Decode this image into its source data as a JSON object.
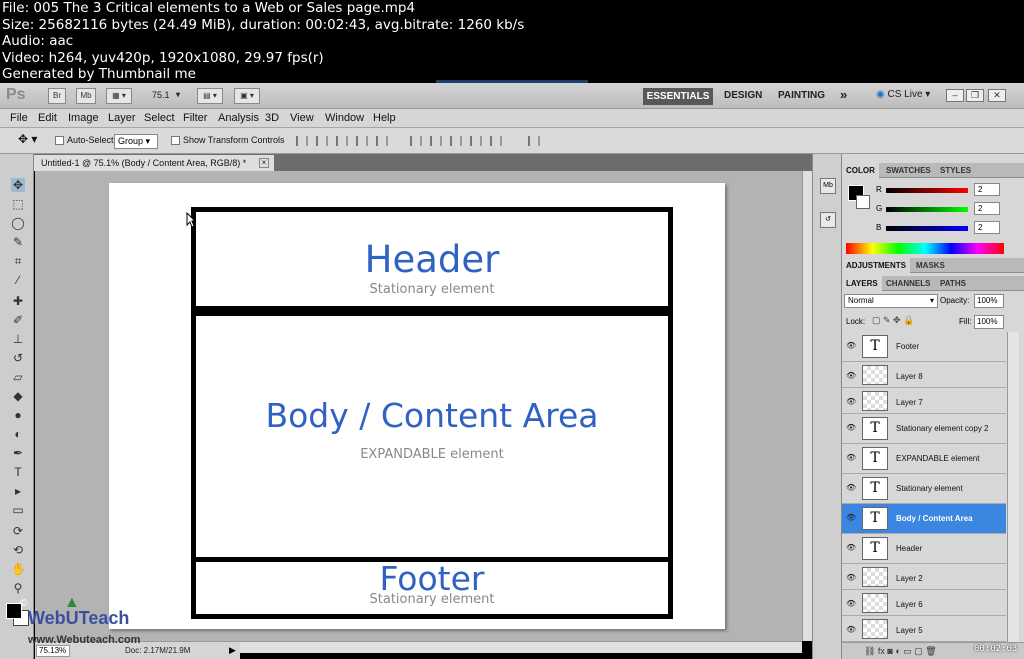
{
  "video_info": [
    "File: 005 The 3 Critical elements to a Web or Sales page.mp4",
    "Size: 25682116 bytes (24.49 MiB), duration: 00:02:43, avg.bitrate: 1260 kb/s",
    "Audio: aac",
    "Video: h264, yuv420p, 1920x1080, 29.97 fps(r)",
    "Generated by Thumbnail me"
  ],
  "appbar": {
    "logo": "Ps",
    "btn_br": "Br",
    "btn_mb": "Mb",
    "zoom": "75.1",
    "workspaces": [
      "ESSENTIALS",
      "DESIGN",
      "PAINTING"
    ],
    "more": "»",
    "cslive": "CS Live"
  },
  "menu": [
    "File",
    "Edit",
    "Image",
    "Layer",
    "Select",
    "Filter",
    "Analysis",
    "3D",
    "View",
    "Window",
    "Help"
  ],
  "options": {
    "auto_select_label": "Auto-Select:",
    "auto_select_value": "Group",
    "show_transform_label": "Show Transform Controls"
  },
  "document_tab": {
    "title": "Untitled-1 @ 75.1% (Body / Content Area, RGB/8) *",
    "close": "×"
  },
  "wireframe": {
    "header_title": "Header",
    "header_sub": "Stationary element",
    "body_title": "Body / Content Area",
    "body_sub": "EXPANDABLE element",
    "footer_title": "Footer",
    "footer_sub": "Stationary element"
  },
  "status": {
    "zoom": "75.13%",
    "doc": "Doc: 2.17M/21.9M"
  },
  "watermark": {
    "brand": "WebUTeach",
    "url": "www.Webuteach.com"
  },
  "panels": {
    "color_tabs": [
      "COLOR",
      "SWATCHES",
      "STYLES"
    ],
    "sliders": [
      {
        "label": "R",
        "value": "2"
      },
      {
        "label": "G",
        "value": "2"
      },
      {
        "label": "B",
        "value": "2"
      }
    ],
    "adjust_tabs": [
      "ADJUSTMENTS",
      "MASKS"
    ],
    "layer_tabs": [
      "LAYERS",
      "CHANNELS",
      "PATHS"
    ],
    "blend_mode": "Normal",
    "opacity_label": "Opacity:",
    "opacity_value": "100%",
    "lock_label": "Lock:",
    "fill_label": "Fill:",
    "fill_value": "100%",
    "layers": [
      {
        "name": "Footer",
        "type": "text"
      },
      {
        "name": "Layer 8",
        "type": "raster"
      },
      {
        "name": "Layer 7",
        "type": "raster"
      },
      {
        "name": "Stationary element copy 2",
        "type": "text"
      },
      {
        "name": "EXPANDABLE element",
        "type": "text"
      },
      {
        "name": "Stationary element",
        "type": "text"
      },
      {
        "name": "Body / Content Area",
        "type": "text",
        "selected": true
      },
      {
        "name": "Header",
        "type": "text"
      },
      {
        "name": "Layer 2",
        "type": "raster"
      },
      {
        "name": "Layer 6",
        "type": "raster"
      },
      {
        "name": "Layer 5",
        "type": "raster"
      }
    ]
  },
  "timecode": "00:02:03",
  "colors": {
    "accent_blue": "#2f62c2",
    "selection": "#3a86e0"
  }
}
